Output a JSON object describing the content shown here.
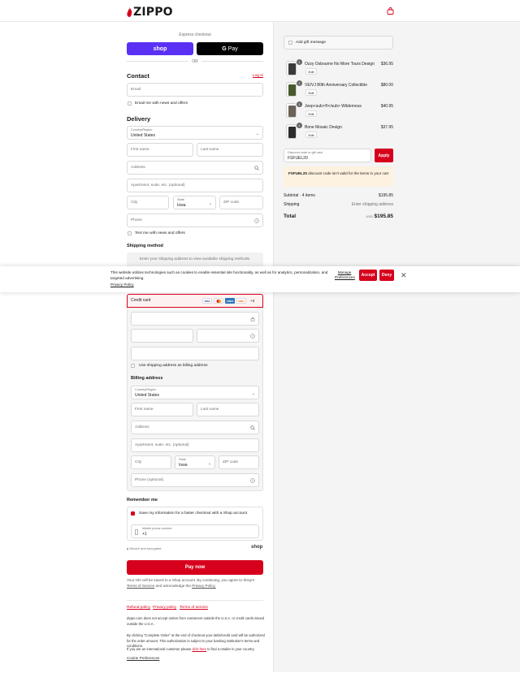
{
  "brand": {
    "name": "ZIPPO",
    "accent": "#d6001c"
  },
  "express": {
    "label": "Express checkout",
    "shop_label": "shop",
    "gpay_label": "Pay",
    "gpay_g": "G",
    "or": "OR"
  },
  "contact": {
    "title": "Contact",
    "login": "Log in",
    "email_placeholder": "Email",
    "news_label": "Email me with news and offers"
  },
  "delivery": {
    "title": "Delivery",
    "country_label": "Country/Region",
    "country_value": "United States",
    "first_name": "First name",
    "last_name": "Last name",
    "address": "Address",
    "apartment": "Apartment, suite, etc. (optional)",
    "city": "City",
    "state_label": "State",
    "state_value": "Iowa",
    "zip": "ZIP code",
    "phone": "Phone",
    "text_label": "Text me with news and offers"
  },
  "shipping": {
    "title": "Shipping method",
    "message": "Enter your shipping address to view available shipping methods."
  },
  "cookie": {
    "text": "This website utilizes technologies such as cookies to enable essential site functionality, as well as for analytics, personalization, and targeted advertising.",
    "privacy": "Privacy Policy",
    "manage": "Manage Preferences",
    "accept": "Accept",
    "deny": "Deny",
    "close": "✕"
  },
  "payment": {
    "method": "Credit card",
    "cards": [
      "VISA",
      "MC",
      "AMEX",
      "DISC"
    ],
    "more": "+3",
    "same_address": "Use shipping address as billing address"
  },
  "billing": {
    "title": "Billing address",
    "country_label": "Country/Region",
    "country_value": "United States",
    "first_name": "First name",
    "last_name": "Last name",
    "address": "Address",
    "apartment": "Apartment, suite, etc. (optional)",
    "city": "City",
    "state_label": "State",
    "state_value": "Iowa",
    "zip": "ZIP code",
    "phone": "Phone (optional)"
  },
  "remember": {
    "title": "Remember me",
    "save_label": "Save my information for a faster checkout with a Shop account",
    "mobile_label": "Mobile phone number",
    "mobile_value": "+1",
    "secure": "Secure and encrypted",
    "shop": "shop"
  },
  "pay_now": "Pay now",
  "terms": {
    "text_before": "Your info will be saved to a Shop account. By continuing, you agree to Shop's",
    "terms_link": "Terms of Service",
    "text_mid": "and acknowledge the",
    "privacy_link": "Privacy Policy."
  },
  "footer": {
    "links": [
      "Refund policy",
      "Privacy policy",
      "Terms of service"
    ],
    "notice1": "Zippo.com does not accept orders from customers outside the U.S.A. or credit cards issued outside the U.S.A.",
    "notice2": "By clicking \"Complete Order\" at the end of checkout your debit/credit card will be authorized for the order amount. This authorization is subject to your banking institution's terms and conditions.",
    "notice3_before": "If you are an international customer please",
    "notice3_link": "click here",
    "notice3_after": "to find a retailer in your country.",
    "cookie_prefs": "Cookie Preferences"
  },
  "summary": {
    "gift": "Add gift message",
    "items": [
      {
        "name": "Ozzy Osbourne No More Tours Design",
        "price": "$36.95",
        "qty": "1",
        "edit": "Edit",
        "color": "#3a3a3a"
      },
      {
        "name": "VE/VJ 80th Anniversary Collectible",
        "price": "$80.00",
        "qty": "1",
        "edit": "Edit",
        "color": "#4a5a2e"
      },
      {
        "name": "Jeep<sub>®</sub> Wilderness",
        "price": "$40.95",
        "qty": "1",
        "edit": "Edit",
        "color": "#6b6358"
      },
      {
        "name": "Bone Mosaic Design",
        "price": "$37.95",
        "qty": "1",
        "edit": "Edit",
        "color": "#2c2c2c"
      }
    ],
    "discount_label": "Discount code or gift card",
    "discount_value": "FSFUEL20",
    "apply": "Apply",
    "warning_code": "FSFUEL20",
    "warning_text": "discount code isn't valid for the items in your cart",
    "subtotal_label": "Subtotal · 4 items",
    "subtotal_value": "$195.85",
    "shipping_label": "Shipping",
    "shipping_value": "Enter shipping address",
    "total_label": "Total",
    "currency": "USD",
    "total_value": "$195.85"
  }
}
